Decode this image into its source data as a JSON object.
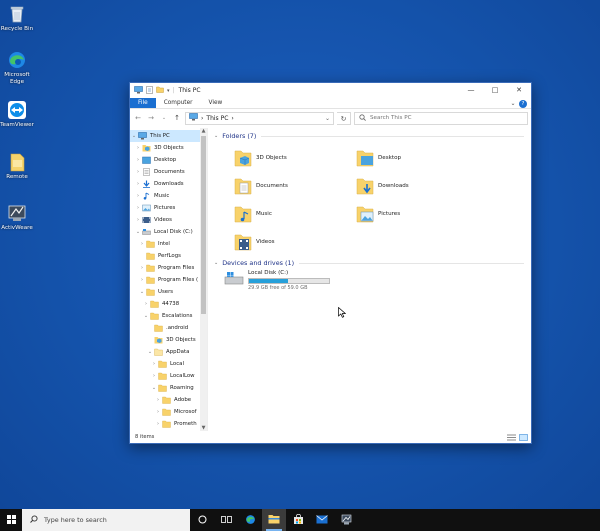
{
  "desktop": {
    "icons": [
      {
        "label": "Recycle Bin",
        "icon": "recycle-bin-icon"
      },
      {
        "label": "Microsoft Edge",
        "icon": "edge-icon"
      },
      {
        "label": "TeamViewer",
        "icon": "teamviewer-icon"
      },
      {
        "label": "Remote",
        "icon": "remote-file-icon"
      },
      {
        "label": "ActivWeare",
        "icon": "activware-icon"
      }
    ]
  },
  "window": {
    "title": "This PC",
    "ribbon_tabs": [
      "File",
      "Computer",
      "View"
    ],
    "address": {
      "separator_1": "›",
      "location": "This PC",
      "separator_2": "›"
    },
    "search_placeholder": "Search This PC",
    "status": "8 items"
  },
  "nav_pane": {
    "items": [
      {
        "label": "This PC",
        "chev": "v",
        "icon": "this-pc-icon"
      },
      {
        "label": "3D Objects",
        "chev": ">",
        "icon": "3d-objects-icon"
      },
      {
        "label": "Desktop",
        "chev": ">",
        "icon": "desktop-folder-icon"
      },
      {
        "label": "Documents",
        "chev": ">",
        "icon": "documents-icon"
      },
      {
        "label": "Downloads",
        "chev": ">",
        "icon": "downloads-icon"
      },
      {
        "label": "Music",
        "chev": ">",
        "icon": "music-icon"
      },
      {
        "label": "Pictures",
        "chev": ">",
        "icon": "pictures-icon"
      },
      {
        "label": "Videos",
        "chev": ">",
        "icon": "videos-icon"
      },
      {
        "label": "Local Disk (C:)",
        "chev": "v",
        "icon": "drive-icon"
      },
      {
        "label": "Intel",
        "chev": ">",
        "icon": "folder-icon"
      },
      {
        "label": "PerfLogs",
        "chev": "",
        "icon": "folder-icon"
      },
      {
        "label": "Program Files",
        "chev": ">",
        "icon": "folder-icon"
      },
      {
        "label": "Program Files (",
        "chev": ">",
        "icon": "folder-icon"
      },
      {
        "label": "Users",
        "chev": "v",
        "icon": "folder-icon"
      },
      {
        "label": "44738",
        "chev": ">",
        "icon": "folder-icon"
      },
      {
        "label": "Escalations",
        "chev": "v",
        "icon": "folder-icon"
      },
      {
        "label": ".android",
        "chev": "",
        "icon": "folder-icon"
      },
      {
        "label": "3D Objects",
        "chev": "",
        "icon": "3d-objects-icon"
      },
      {
        "label": "AppData",
        "chev": "v",
        "icon": "folder-icon"
      },
      {
        "label": "Local",
        "chev": ">",
        "icon": "folder-icon"
      },
      {
        "label": "LocalLow",
        "chev": ">",
        "icon": "folder-icon"
      },
      {
        "label": "Roaming",
        "chev": "v",
        "icon": "folder-icon"
      },
      {
        "label": "Adobe",
        "chev": ">",
        "icon": "folder-icon"
      },
      {
        "label": "Microsof",
        "chev": ">",
        "icon": "folder-icon"
      },
      {
        "label": "Prometh",
        "chev": ">",
        "icon": "folder-icon"
      }
    ]
  },
  "content": {
    "folders_header": "Folders (7)",
    "folders": [
      {
        "label": "3D Objects",
        "icon": "3d-objects-icon"
      },
      {
        "label": "Desktop",
        "icon": "desktop-folder-icon"
      },
      {
        "label": "Documents",
        "icon": "documents-icon"
      },
      {
        "label": "Downloads",
        "icon": "downloads-icon"
      },
      {
        "label": "Music",
        "icon": "music-icon"
      },
      {
        "label": "Pictures",
        "icon": "pictures-icon"
      },
      {
        "label": "Videos",
        "icon": "videos-icon"
      }
    ],
    "devices_header": "Devices and drives (1)",
    "drive": {
      "label": "Local Disk (C:)",
      "size": "29.9 GB free of 59.0 GB",
      "used_fraction": 0.49
    }
  },
  "taskbar": {
    "search_placeholder": "Type here to search",
    "icons": [
      "cortana-icon",
      "task-view-icon",
      "edge-icon",
      "file-explorer-icon",
      "store-icon",
      "mail-icon",
      "app-icon"
    ]
  },
  "colors": {
    "accent": "#1a6fd1",
    "desktop": "#1653a8",
    "folder": "#f8d26a",
    "drive_bar": "#26a0da"
  }
}
